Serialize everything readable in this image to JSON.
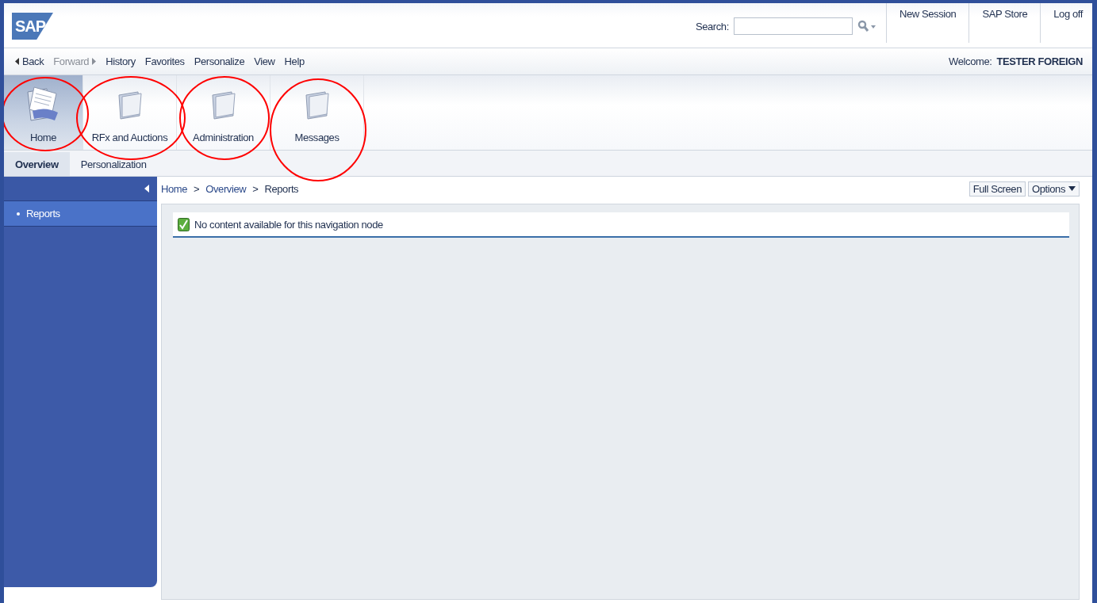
{
  "logo": "SAP",
  "search": {
    "label": "Search:"
  },
  "header_links": [
    "New Session",
    "SAP Store",
    "Log off"
  ],
  "menu": [
    {
      "label": "Back",
      "kind": "back",
      "disabled": false
    },
    {
      "label": "Forward",
      "kind": "forward",
      "disabled": true
    },
    {
      "label": "History",
      "kind": "plain",
      "disabled": false
    },
    {
      "label": "Favorites",
      "kind": "plain",
      "disabled": false
    },
    {
      "label": "Personalize",
      "kind": "plain",
      "disabled": false
    },
    {
      "label": "View",
      "kind": "plain",
      "disabled": false
    },
    {
      "label": "Help",
      "kind": "plain",
      "disabled": false
    }
  ],
  "welcome": {
    "label": "Welcome:",
    "user": "TESTER FOREIGN"
  },
  "top_nav": [
    {
      "label": "Home",
      "kind": "home",
      "selected": true
    },
    {
      "label": "RFx and Auctions",
      "kind": "folder",
      "selected": false
    },
    {
      "label": "Administration",
      "kind": "folder",
      "selected": false
    },
    {
      "label": "Messages",
      "kind": "folder",
      "selected": false
    }
  ],
  "sub_nav": [
    {
      "label": "Overview",
      "selected": true
    },
    {
      "label": "Personalization",
      "selected": false
    }
  ],
  "sidebar": {
    "items": [
      {
        "label": "Reports",
        "selected": true
      }
    ]
  },
  "breadcrumb": {
    "items": [
      "Home",
      "Overview",
      "Reports"
    ],
    "separator": ">"
  },
  "page_buttons": [
    {
      "label": "Full Screen",
      "kind": "plain"
    },
    {
      "label": "Options",
      "kind": "dropdown"
    }
  ],
  "message": {
    "text": "No content available for this navigation node",
    "kind": "success"
  }
}
